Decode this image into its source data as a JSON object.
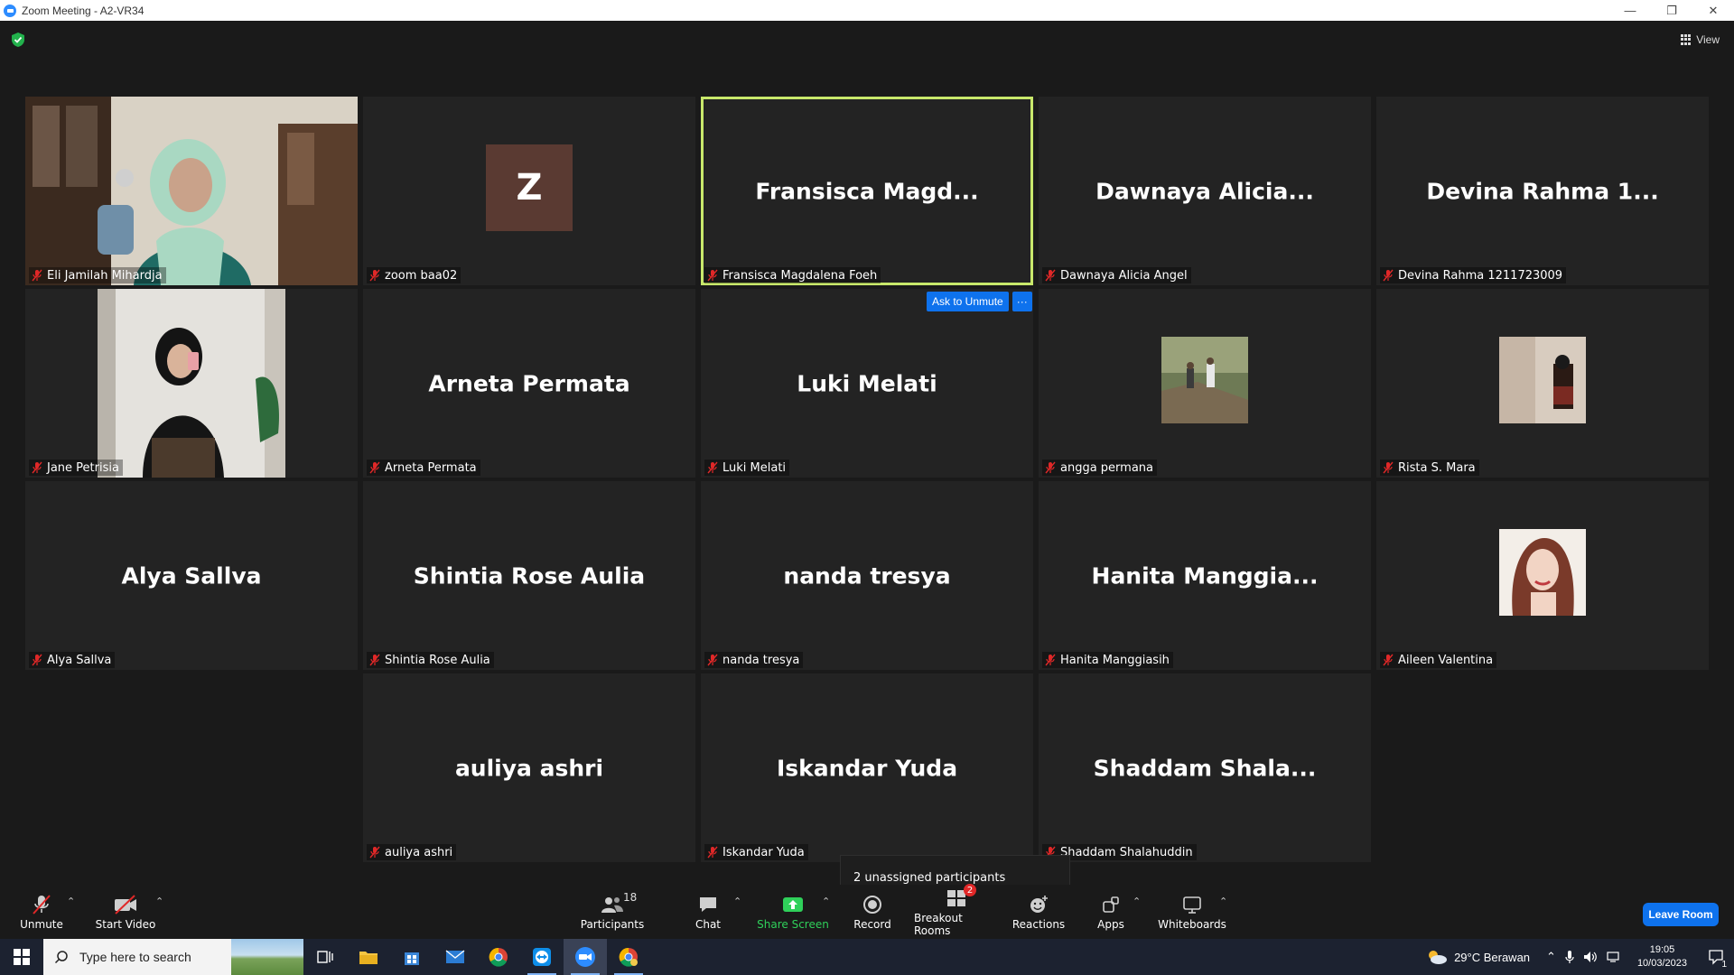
{
  "window": {
    "title": "Zoom Meeting - A2-VR34",
    "controls": {
      "minimize": "—",
      "restore": "❐",
      "close": "✕"
    }
  },
  "meeting": {
    "view_label": "View",
    "ask_unmute_label": "Ask to Unmute",
    "more_label": "···",
    "tooltip": "2 unassigned participants",
    "tiles": [
      {
        "center": "",
        "label": "Eli Jamilah Mihardja",
        "kind": "video-woman"
      },
      {
        "center": "",
        "label": "zoom baa02",
        "kind": "avatar",
        "initial": "Z"
      },
      {
        "center": "Fransisca  Magd...",
        "label": "Fransisca Magdalena Foeh",
        "kind": "name",
        "active": true
      },
      {
        "center": "Dawnaya  Alicia...",
        "label": "Dawnaya Alicia Angel",
        "kind": "name"
      },
      {
        "center": "Devina  Rahma  1...",
        "label": "Devina Rahma 1211723009",
        "kind": "name"
      },
      {
        "center": "",
        "label": "Jane Petrisia",
        "kind": "video-mirror"
      },
      {
        "center": "Arneta Permata",
        "label": "Arneta Permata",
        "kind": "name"
      },
      {
        "center": "Luki Melati",
        "label": "Luki Melati",
        "kind": "name"
      },
      {
        "center": "",
        "label": "angga permana",
        "kind": "thumb-forest"
      },
      {
        "center": "",
        "label": "Rista S. Mara",
        "kind": "thumb-room"
      },
      {
        "center": "Alya Sallva",
        "label": "Alya Sallva",
        "kind": "name"
      },
      {
        "center": "Shintia Rose Aulia",
        "label": "Shintia Rose Aulia",
        "kind": "name"
      },
      {
        "center": "nanda tresya",
        "label": "nanda tresya",
        "kind": "name"
      },
      {
        "center": "Hanita  Manggia...",
        "label": "Hanita Manggiasih",
        "kind": "name"
      },
      {
        "center": "",
        "label": "Aileen Valentina",
        "kind": "thumb-portrait"
      },
      {
        "center": "auliya ashri",
        "label": "auliya ashri",
        "kind": "name"
      },
      {
        "center": "Iskandar Yuda",
        "label": "Iskandar Yuda",
        "kind": "name"
      },
      {
        "center": "Shaddam  Shala...",
        "label": "Shaddam Shalahuddin",
        "kind": "name"
      }
    ]
  },
  "toolbar": {
    "unmute": "Unmute",
    "start_video": "Start Video",
    "participants": "Participants",
    "participants_count": "18",
    "chat": "Chat",
    "share_screen": "Share Screen",
    "record": "Record",
    "breakout_rooms": "Breakout Rooms",
    "breakout_badge": "2",
    "reactions": "Reactions",
    "apps": "Apps",
    "whiteboards": "Whiteboards",
    "leave": "Leave Room"
  },
  "taskbar": {
    "search_placeholder": "Type here to search",
    "weather": "29°C  Berawan",
    "time": "19:05",
    "date": "10/03/2023",
    "notification_count": "1"
  },
  "colors": {
    "active_speaker": "#c8e86b",
    "accent_blue": "#0e72ed",
    "share_green": "#2fd05a",
    "mic_off_red": "#e02828"
  }
}
